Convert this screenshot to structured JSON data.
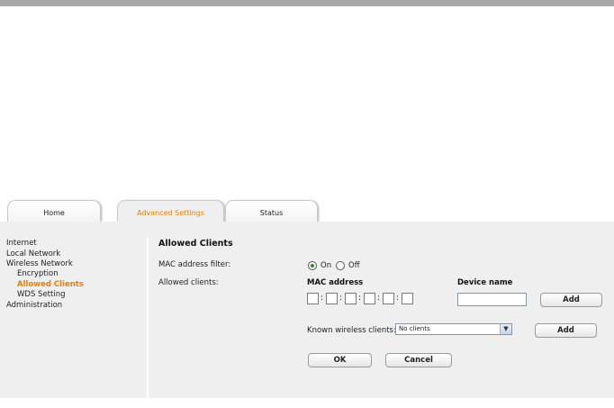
{
  "tabs": {
    "home": "Home",
    "advanced": "Advanced Settings",
    "status": "Status"
  },
  "sidebar": {
    "items": [
      {
        "label": "Internet"
      },
      {
        "label": "Local Network"
      },
      {
        "label": "Wireless Network"
      },
      {
        "label": "Encryption"
      },
      {
        "label": "Allowed Clients"
      },
      {
        "label": "WDS Setting"
      },
      {
        "label": "Administration"
      }
    ]
  },
  "main": {
    "title": "Allowed Clients",
    "mac_filter_label": "MAC address filter:",
    "on_label": "On",
    "off_label": "Off",
    "allowed_clients_label": "Allowed clients:",
    "mac_address_header": "MAC address",
    "device_name_header": "Device name",
    "mac_separator": ":",
    "add_label": "Add",
    "known_clients_label": "Known wireless clients:",
    "known_clients_selected": "No clients",
    "add2_label": "Add",
    "ok_label": "OK",
    "cancel_label": "Cancel"
  },
  "colors": {
    "accent": "#f07d00",
    "panel": "#efefef",
    "topbar": "#a8a8a8"
  }
}
